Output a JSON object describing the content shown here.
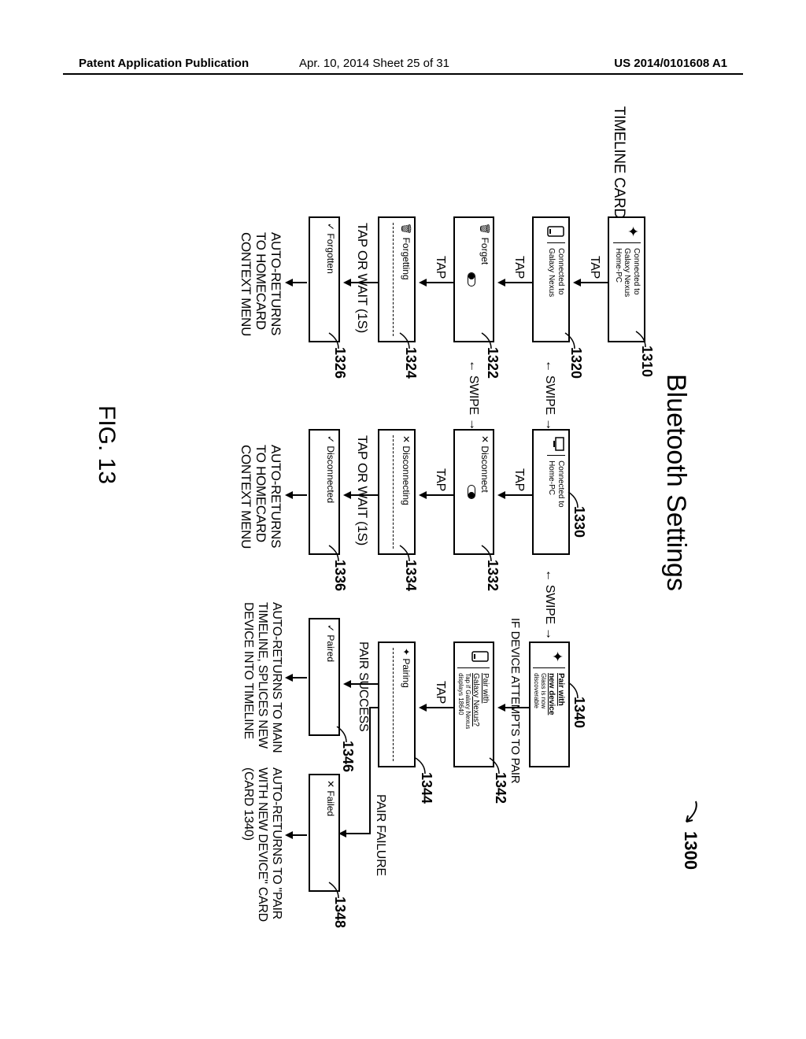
{
  "header": {
    "left": "Patent Application Publication",
    "center": "Apr. 10, 2014  Sheet 25 of 31",
    "right": "US 2014/0101608 A1"
  },
  "figure": {
    "number": "1300",
    "title": "Bluetooth Settings",
    "caption": "FIG. 13",
    "timeline_label": "TIMELINE CARD"
  },
  "refs": {
    "c1310": "1310",
    "c1320": "1320",
    "c1322": "1322",
    "c1324": "1324",
    "c1326": "1326",
    "c1330": "1330",
    "c1332": "1332",
    "c1334": "1334",
    "c1336": "1336",
    "c1340": "1340",
    "c1342": "1342",
    "c1344": "1344",
    "c1346": "1346",
    "c1348": "1348"
  },
  "cards": {
    "c1310": {
      "text": "Connected to\nGalaxy Nexus\nHome-PC"
    },
    "c1320": {
      "text": "Connected to\nGalaxy Nexus"
    },
    "c1322": {
      "text": "Forget"
    },
    "c1324": {
      "text": "Forgetting"
    },
    "c1326": {
      "text": "Forgotten"
    },
    "c1330": {
      "text": "Connected to\nHome-PC"
    },
    "c1332": {
      "text": "Disconnect"
    },
    "c1334": {
      "text": "Disconnecting"
    },
    "c1336": {
      "text": "Disconnected"
    },
    "c1340": {
      "title": "Pair with\nnew device",
      "sub": "Glass is now\ndiscoverable"
    },
    "c1342": {
      "title": "Pair with\nGalaxy Nexus?",
      "sub": "Tap if Galaxy Nexus\ndisplays 18640"
    },
    "c1344": {
      "text": "Pairing"
    },
    "c1346": {
      "text": "Paired"
    },
    "c1348": {
      "text": "Failed"
    }
  },
  "labels": {
    "tap": "TAP",
    "swipe": "SWIPE",
    "tap_or_wait": "TAP OR WAIT (1S)",
    "if_device": "IF DEVICE ATTEMPTS TO PAIR",
    "pair_success": "PAIR SUCCESS",
    "pair_failure": "PAIR FAILURE",
    "auto_homecard": "AUTO-RETURNS\nTO HOMECARD\nCONTEXT MENU",
    "auto_main": "AUTO-RETURNS TO MAIN\nTIMELINE, SPLICES NEW\nDEVICE INTO TIMELINE",
    "auto_pair": "AUTO-RETURNS TO \"PAIR\nWITH NEW DEVICE\" CARD\n(CARD 1340)"
  }
}
